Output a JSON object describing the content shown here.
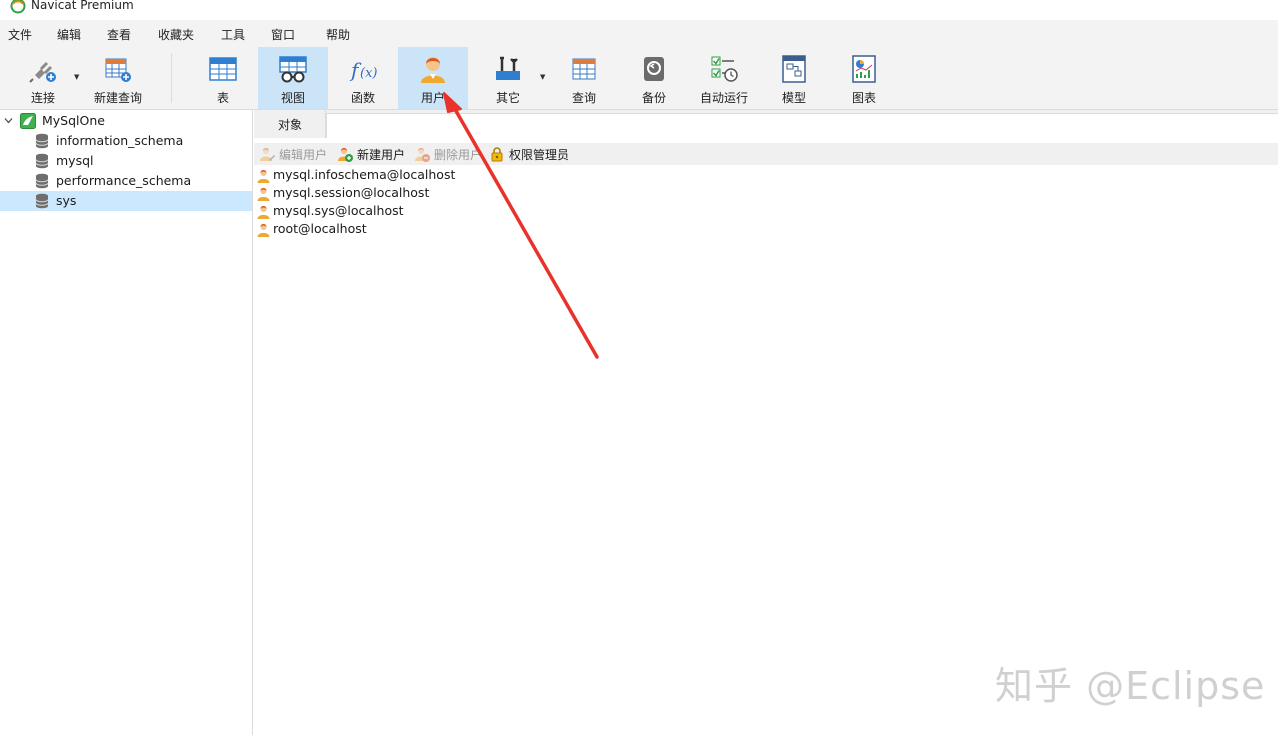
{
  "app": {
    "title": "Navicat Premium"
  },
  "menu": [
    "文件",
    "编辑",
    "查看",
    "收藏夹",
    "工具",
    "窗口",
    "帮助"
  ],
  "toolbar": {
    "buttons": [
      {
        "label": "连接",
        "icon": "connection-plug-icon",
        "dropdown": true,
        "active": false
      },
      {
        "label": "新建查询",
        "icon": "new-query-icon",
        "dropdown": false,
        "active": false
      },
      {
        "label": "表",
        "icon": "table-icon",
        "dropdown": false,
        "active": false
      },
      {
        "label": "视图",
        "icon": "view-glasses-icon",
        "dropdown": false,
        "active": true
      },
      {
        "label": "函数",
        "icon": "function-fx-icon",
        "dropdown": false,
        "active": false
      },
      {
        "label": "用户",
        "icon": "user-icon",
        "dropdown": false,
        "active": true
      },
      {
        "label": "其它",
        "icon": "tools-icon",
        "dropdown": true,
        "active": false
      },
      {
        "label": "查询",
        "icon": "query-icon",
        "dropdown": false,
        "active": false
      },
      {
        "label": "备份",
        "icon": "backup-icon",
        "dropdown": false,
        "active": false
      },
      {
        "label": "自动运行",
        "icon": "autorun-icon",
        "dropdown": false,
        "active": false
      },
      {
        "label": "模型",
        "icon": "model-icon",
        "dropdown": false,
        "active": false
      },
      {
        "label": "图表",
        "icon": "chart-icon",
        "dropdown": false,
        "active": false
      }
    ]
  },
  "sidebar": {
    "connection": "MySqlOne",
    "databases": [
      "information_schema",
      "mysql",
      "performance_schema",
      "sys"
    ],
    "selected": "sys"
  },
  "main": {
    "tab": "对象",
    "actions": [
      {
        "label": "编辑用户",
        "icon": "edit-user-icon",
        "enabled": false
      },
      {
        "label": "新建用户",
        "icon": "new-user-icon",
        "enabled": true
      },
      {
        "label": "删除用户",
        "icon": "delete-user-icon",
        "enabled": false
      },
      {
        "label": "权限管理员",
        "icon": "lock-icon",
        "enabled": true
      }
    ],
    "users": [
      "mysql.infoschema@localhost",
      "mysql.session@localhost",
      "mysql.sys@localhost",
      "root@localhost"
    ]
  },
  "watermark": "知乎 @Eclipse",
  "colors": {
    "active_button": "#cce4f7",
    "selected_row": "#cce8ff",
    "arrow": "#e8322b",
    "user_icon": "#f0a830"
  }
}
